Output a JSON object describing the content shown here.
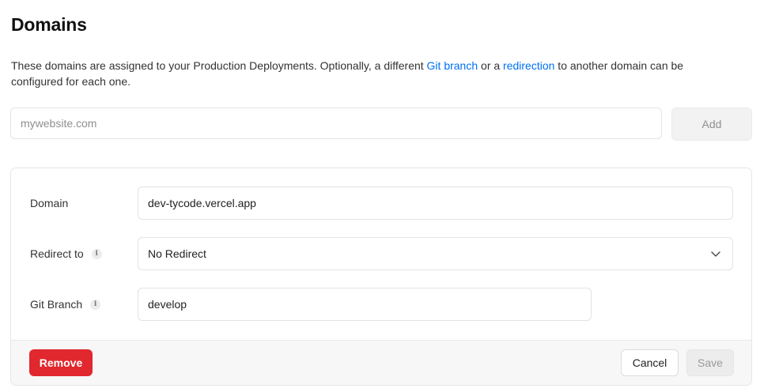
{
  "header": {
    "title": "Domains"
  },
  "description": {
    "part1": "These domains are assigned to your Production Deployments. Optionally, a different ",
    "link_git_branch": "Git branch",
    "part2": " or a ",
    "link_redirection": "redirection",
    "part3": " to another domain can be configured for each one."
  },
  "add_domain": {
    "placeholder": "mywebsite.com",
    "value": "",
    "button_label": "Add"
  },
  "domain_card": {
    "domain_label": "Domain",
    "domain_value": "dev-tycode.vercel.app",
    "redirect_label": "Redirect to",
    "redirect_value": "No Redirect",
    "git_branch_label": "Git Branch",
    "git_branch_value": "develop",
    "info_glyph": "i",
    "remove_label": "Remove",
    "cancel_label": "Cancel",
    "save_label": "Save"
  },
  "colors": {
    "link": "#0070f3",
    "danger": "#e0282e",
    "disabled_bg": "#f2f2f2",
    "footer_bg": "#f7f7f7"
  },
  "icons": {
    "info": "info-icon",
    "chevron": "chevron-down-icon"
  }
}
